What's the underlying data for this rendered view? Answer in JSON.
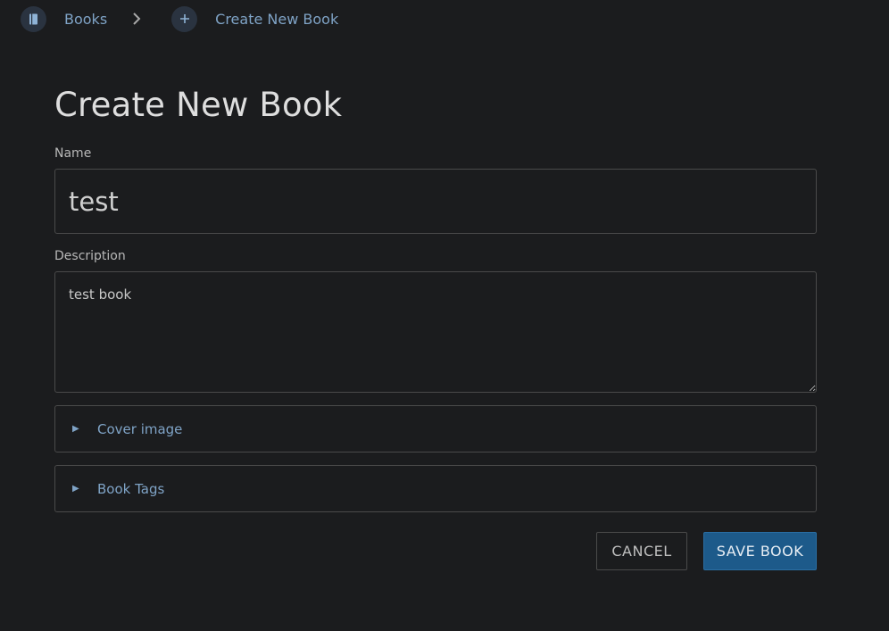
{
  "breadcrumb": {
    "items": [
      {
        "label": "Books",
        "icon": "book-icon"
      },
      {
        "label": "Create New Book",
        "icon": "plus-icon"
      }
    ],
    "separator_icon": "chevron-right-icon"
  },
  "page": {
    "title": "Create New Book"
  },
  "form": {
    "name_label": "Name",
    "name_value": "test",
    "description_label": "Description",
    "description_value": "test book",
    "sections": [
      {
        "label": "Cover image",
        "icon": "triangle-right-icon"
      },
      {
        "label": "Book Tags",
        "icon": "triangle-right-icon"
      }
    ],
    "cancel_label": "CANCEL",
    "save_label": "SAVE BOOK"
  },
  "colors": {
    "background": "#1b1c1e",
    "link": "#7fa3c6",
    "primary_button": "#1d5a8a",
    "border": "#4a4a4a"
  }
}
